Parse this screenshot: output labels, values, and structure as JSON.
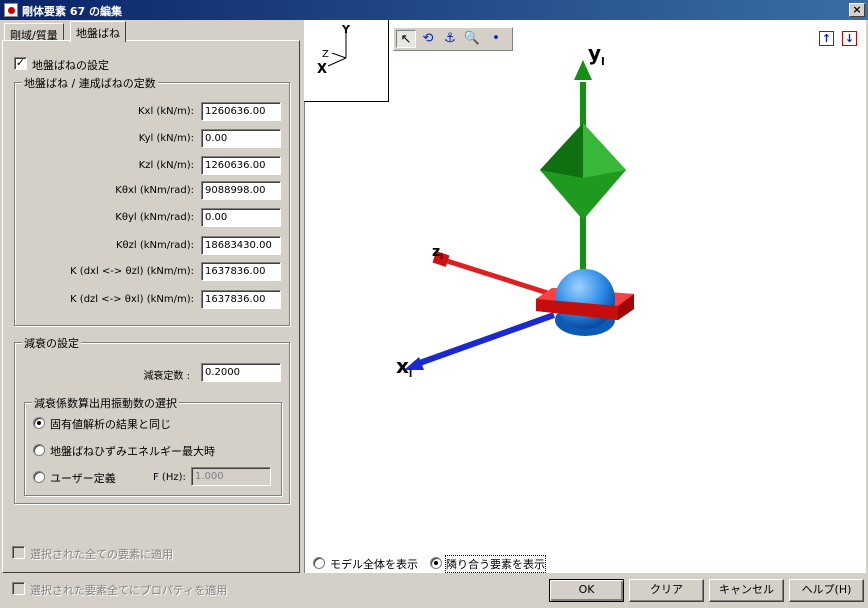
{
  "window": {
    "title": "剛体要素 67 の編集",
    "close_label": "×"
  },
  "tabs": [
    {
      "label": "剛域/質量"
    },
    {
      "label": "地盤ばね"
    }
  ],
  "spring": {
    "enable_label": "地盤ばねの設定",
    "enable_mark": "✓",
    "group_title": "地盤ばね / 連成ばねの定数",
    "rows": [
      {
        "label": "Kxl (kN/m):",
        "value": "1260636.00"
      },
      {
        "label": "Kyl (kN/m):",
        "value": "0.00"
      },
      {
        "label": "Kzl (kN/m):",
        "value": "1260636.00"
      },
      {
        "label": "Kθxl (kNm/rad):",
        "value": "9088998.00"
      },
      {
        "label": "Kθyl (kNm/rad):",
        "value": "0.00"
      },
      {
        "label": "Kθzl (kNm/rad):",
        "value": "18683430.00"
      },
      {
        "label": "K (dxl <-> θzl) (kNm/m):",
        "value": "1637836.00"
      },
      {
        "label": "K (dzl <-> θxl) (kNm/m):",
        "value": "1637836.00"
      }
    ]
  },
  "damping": {
    "group_title": "減衰の設定",
    "constant_label": "減衰定数 :",
    "constant_value": "0.2000",
    "freq_group_title": "減衰係数算出用振動数の選択",
    "options": [
      {
        "label": "固有値解析の結果と同じ",
        "selected": true
      },
      {
        "label": "地盤ばねひずみエネルギー最大時",
        "selected": false
      },
      {
        "label": "ユーザー定義",
        "selected": false
      }
    ],
    "freq_label": "F (Hz):",
    "freq_value": "1.000"
  },
  "apply_selected_label": "選択された全ての要素に適用",
  "apply_props_label": "選択された要素全てにプロパティを適用",
  "viewport": {
    "axis_labels": {
      "y": "Y",
      "z": "Z",
      "x": "X"
    },
    "model_axis_labels": {
      "y": "y",
      "y_sub": "l",
      "z": "z",
      "z_sub": "l",
      "x": "x",
      "x_sub": "l"
    },
    "toolbar_icons": [
      "pointer-icon",
      "rotate-icon",
      "pan-icon",
      "zoom-icon",
      "dot-icon"
    ],
    "toolbar_glyphs": [
      "↖",
      "⟲",
      "⚓",
      "🔍",
      "•"
    ],
    "export_glyphs": [
      "↑",
      "↓"
    ],
    "view_options": [
      {
        "label": "モデル全体を表示",
        "selected": false
      },
      {
        "label": "隣り合う要素を表示",
        "selected": true
      }
    ],
    "colors": {
      "y_axis": "#159015",
      "z_axis": "#e02020",
      "x_axis": "#1a2ad0",
      "sphere": "#2a8ae6",
      "plate": "#e81818"
    }
  },
  "buttons": {
    "ok": "OK",
    "clear": "クリア",
    "cancel": "キャンセル",
    "help": "ヘルプ(H)"
  }
}
